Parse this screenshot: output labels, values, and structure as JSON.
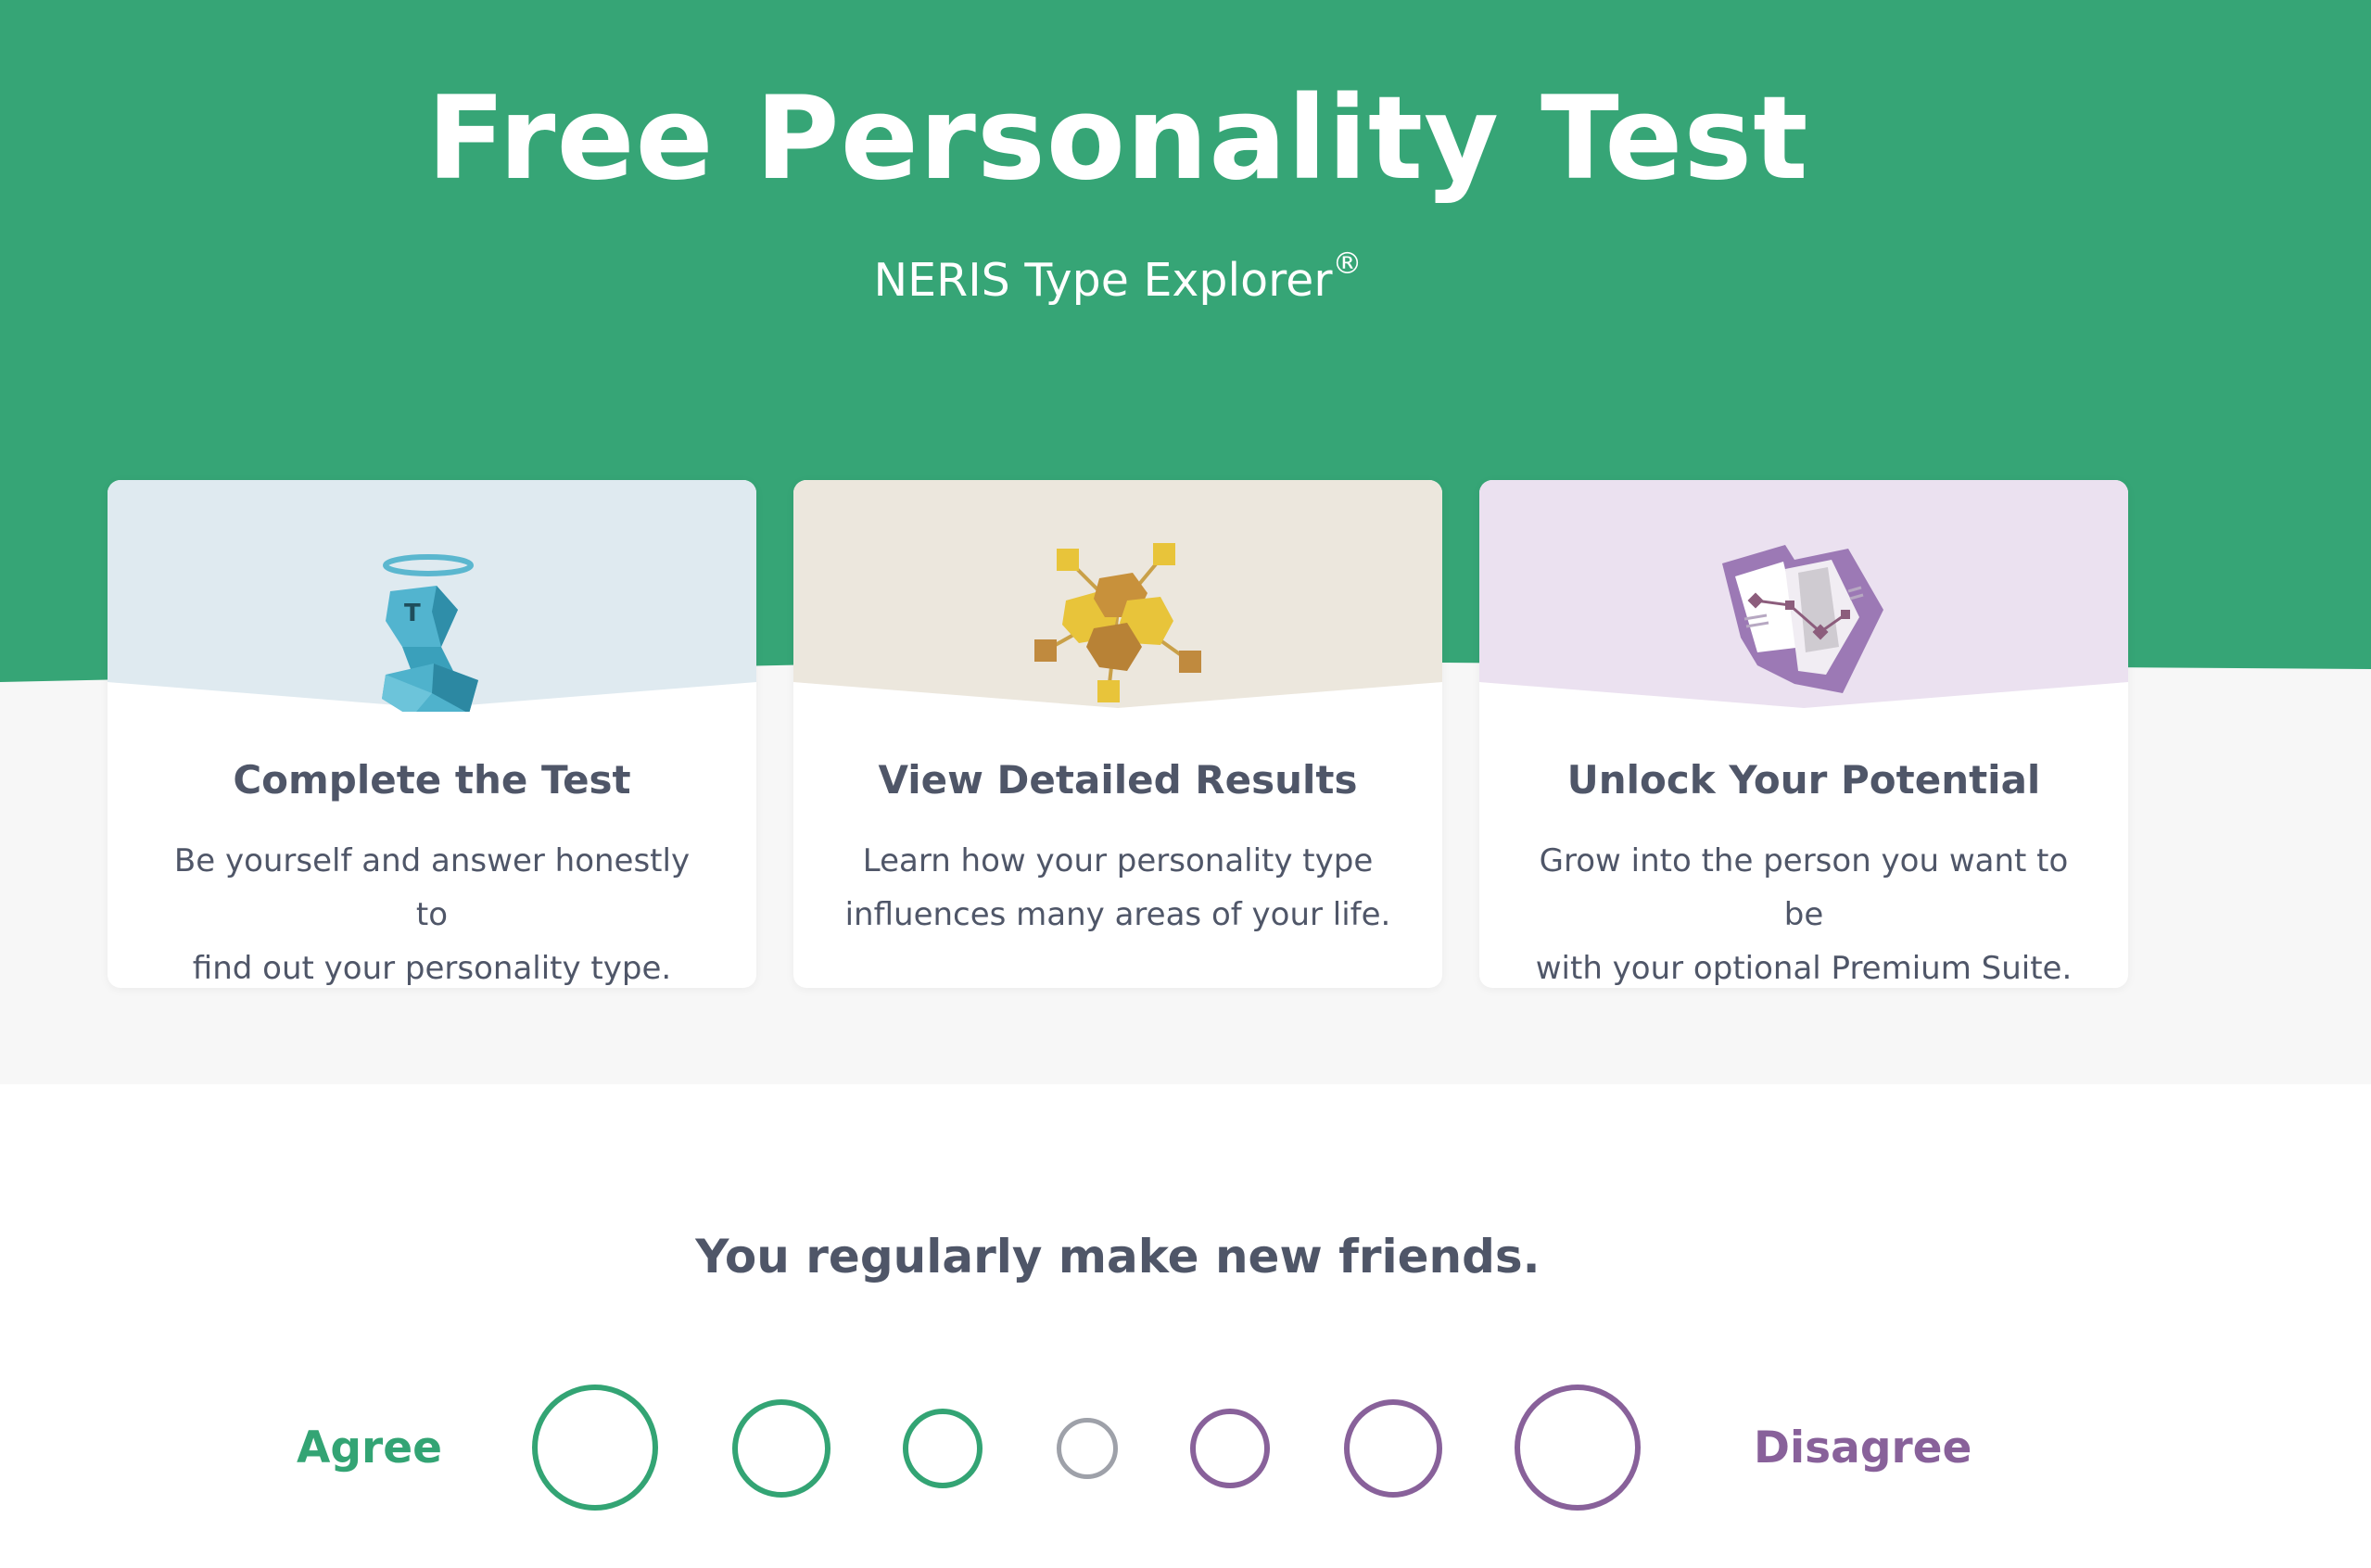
{
  "hero": {
    "title": "Free Personality Test",
    "subtitle": "NERIS Type Explorer",
    "subtitle_mark": "®",
    "background_color": "#36a576"
  },
  "cards": [
    {
      "title": "Complete the Test",
      "desc_line1": "Be yourself and answer honestly to",
      "desc_line2": "find out your personality type.",
      "illustration": "halo-figure-icon",
      "tint": "#dfeaf0"
    },
    {
      "title": "View Detailed Results",
      "desc_line1": "Learn how your personality type",
      "desc_line2": "influences many areas of your life.",
      "illustration": "connected-cubes-icon",
      "tint": "#ece7dd"
    },
    {
      "title": "Unlock Your Potential",
      "desc_line1": "Grow into the person you want to be",
      "desc_line2": "with your optional Premium Suite.",
      "illustration": "map-document-icon",
      "tint": "#ebe1f0"
    }
  ],
  "question": {
    "text": "You regularly make new friends.",
    "agree_label": "Agree",
    "disagree_label": "Disagree",
    "options": [
      "strongly-agree",
      "agree",
      "slightly-agree",
      "neutral",
      "slightly-disagree",
      "disagree",
      "strongly-disagree"
    ],
    "agree_color": "#33a474",
    "neutral_color": "#9ea1a9",
    "disagree_color": "#88619a"
  }
}
